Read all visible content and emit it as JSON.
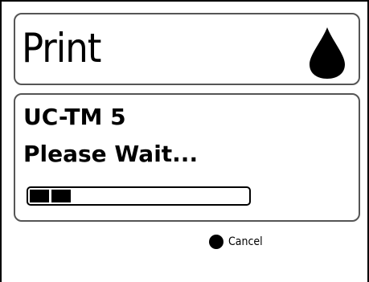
{
  "header": {
    "title": "Print",
    "icon": "ink-drop-icon"
  },
  "status": {
    "job_name": "UC-TM 5",
    "message": "Please Wait...",
    "progress_segments_filled": 2,
    "progress_fraction": 0.2
  },
  "actions": {
    "cancel_label": "Cancel",
    "cancel_icon": "filled-circle-icon"
  },
  "colors": {
    "foreground": "#000000",
    "background": "#ffffff",
    "panel_border": "#555555"
  }
}
